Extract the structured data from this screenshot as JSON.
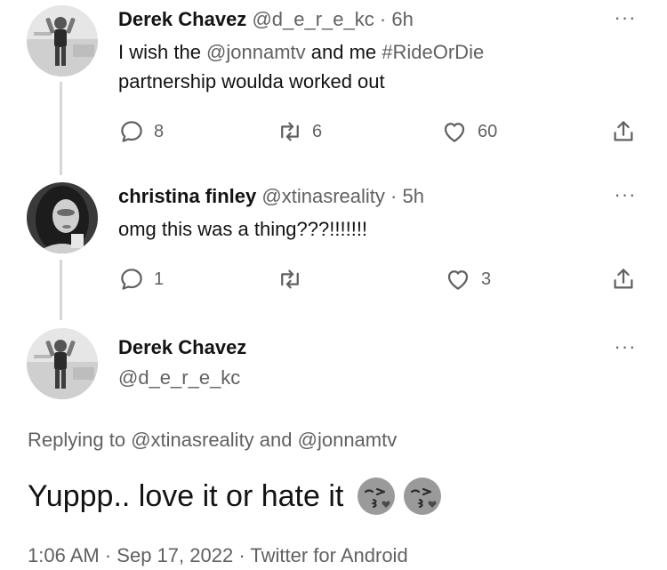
{
  "reply1": {
    "author_name": "Derek Chavez",
    "author_handle": "@d_e_r_e_kc",
    "separator": "·",
    "time": "6h",
    "more_label": "···",
    "text_part1": "I wish the ",
    "mention": "@jonnamtv",
    "text_part2": " and me ",
    "hashtag": "#RideOrDie",
    "text_line2": "partnership woulda worked out",
    "replies": "8",
    "retweets": "6",
    "likes": "60"
  },
  "reply2": {
    "author_name": "christina finley",
    "author_handle": "@xtinasreality",
    "separator": "·",
    "time": "5h",
    "more_label": "···",
    "text": "omg this was a thing???!!!!!!!",
    "replies": "1",
    "retweets": "",
    "likes": "3"
  },
  "main_tweet": {
    "author_name": "Derek Chavez",
    "author_handle": "@d_e_r_e_kc",
    "more_label": "···",
    "replying_prefix": "Replying to ",
    "replying_mention1": "@xtinasreality",
    "replying_and": " and ",
    "replying_mention2": "@jonnamtv",
    "text": "Yuppp.. love it or hate it",
    "emoji": "kissing-face-with-closed-eyes",
    "emoji_count": 2,
    "time": "1:06 AM",
    "separator": "·",
    "date": "Sep 17, 2022",
    "source": "Twitter for Android"
  },
  "icons": {
    "reply": "reply-icon",
    "retweet": "retweet-icon",
    "like": "heart-icon",
    "share": "share-icon",
    "more": "more-icon"
  },
  "colors": {
    "text": "#0f1419",
    "secondary": "#536471",
    "thread_line": "#cfd9de"
  }
}
